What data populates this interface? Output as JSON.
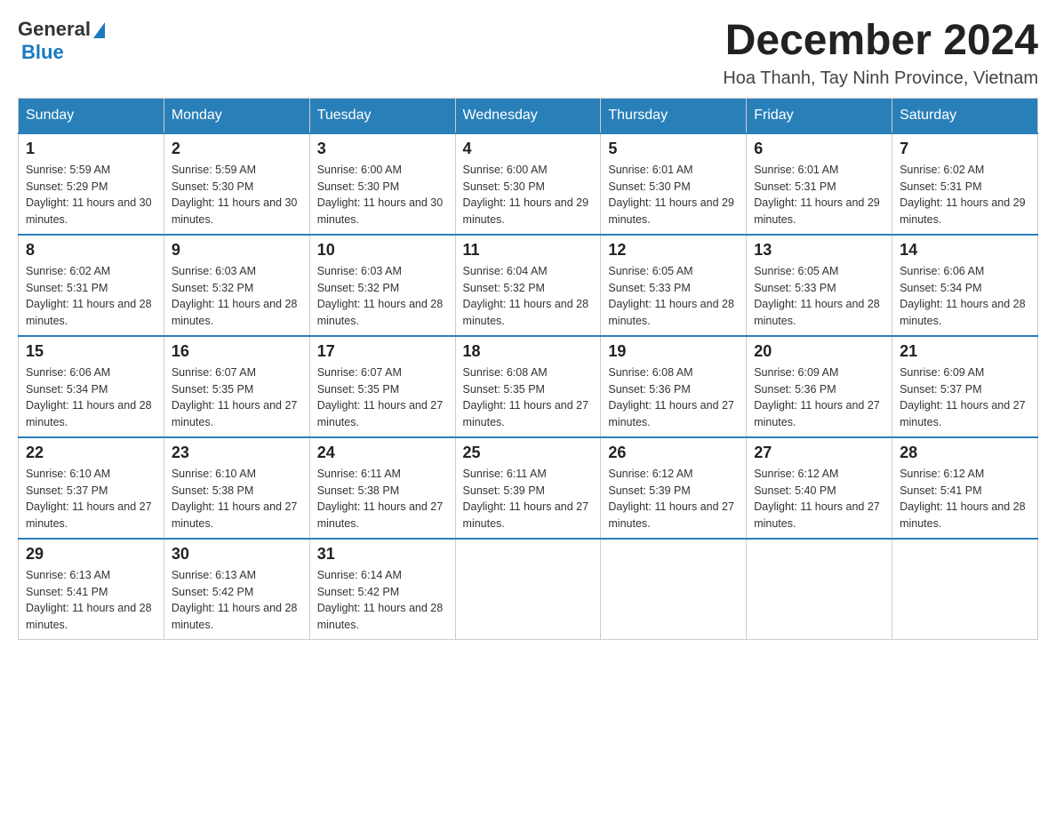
{
  "header": {
    "logo_general": "General",
    "logo_blue": "Blue",
    "month_title": "December 2024",
    "location": "Hoa Thanh, Tay Ninh Province, Vietnam"
  },
  "days_of_week": [
    "Sunday",
    "Monday",
    "Tuesday",
    "Wednesday",
    "Thursday",
    "Friday",
    "Saturday"
  ],
  "weeks": [
    [
      {
        "day": "1",
        "sunrise": "5:59 AM",
        "sunset": "5:29 PM",
        "daylight": "11 hours and 30 minutes."
      },
      {
        "day": "2",
        "sunrise": "5:59 AM",
        "sunset": "5:30 PM",
        "daylight": "11 hours and 30 minutes."
      },
      {
        "day": "3",
        "sunrise": "6:00 AM",
        "sunset": "5:30 PM",
        "daylight": "11 hours and 30 minutes."
      },
      {
        "day": "4",
        "sunrise": "6:00 AM",
        "sunset": "5:30 PM",
        "daylight": "11 hours and 29 minutes."
      },
      {
        "day": "5",
        "sunrise": "6:01 AM",
        "sunset": "5:30 PM",
        "daylight": "11 hours and 29 minutes."
      },
      {
        "day": "6",
        "sunrise": "6:01 AM",
        "sunset": "5:31 PM",
        "daylight": "11 hours and 29 minutes."
      },
      {
        "day": "7",
        "sunrise": "6:02 AM",
        "sunset": "5:31 PM",
        "daylight": "11 hours and 29 minutes."
      }
    ],
    [
      {
        "day": "8",
        "sunrise": "6:02 AM",
        "sunset": "5:31 PM",
        "daylight": "11 hours and 28 minutes."
      },
      {
        "day": "9",
        "sunrise": "6:03 AM",
        "sunset": "5:32 PM",
        "daylight": "11 hours and 28 minutes."
      },
      {
        "day": "10",
        "sunrise": "6:03 AM",
        "sunset": "5:32 PM",
        "daylight": "11 hours and 28 minutes."
      },
      {
        "day": "11",
        "sunrise": "6:04 AM",
        "sunset": "5:32 PM",
        "daylight": "11 hours and 28 minutes."
      },
      {
        "day": "12",
        "sunrise": "6:05 AM",
        "sunset": "5:33 PM",
        "daylight": "11 hours and 28 minutes."
      },
      {
        "day": "13",
        "sunrise": "6:05 AM",
        "sunset": "5:33 PM",
        "daylight": "11 hours and 28 minutes."
      },
      {
        "day": "14",
        "sunrise": "6:06 AM",
        "sunset": "5:34 PM",
        "daylight": "11 hours and 28 minutes."
      }
    ],
    [
      {
        "day": "15",
        "sunrise": "6:06 AM",
        "sunset": "5:34 PM",
        "daylight": "11 hours and 28 minutes."
      },
      {
        "day": "16",
        "sunrise": "6:07 AM",
        "sunset": "5:35 PM",
        "daylight": "11 hours and 27 minutes."
      },
      {
        "day": "17",
        "sunrise": "6:07 AM",
        "sunset": "5:35 PM",
        "daylight": "11 hours and 27 minutes."
      },
      {
        "day": "18",
        "sunrise": "6:08 AM",
        "sunset": "5:35 PM",
        "daylight": "11 hours and 27 minutes."
      },
      {
        "day": "19",
        "sunrise": "6:08 AM",
        "sunset": "5:36 PM",
        "daylight": "11 hours and 27 minutes."
      },
      {
        "day": "20",
        "sunrise": "6:09 AM",
        "sunset": "5:36 PM",
        "daylight": "11 hours and 27 minutes."
      },
      {
        "day": "21",
        "sunrise": "6:09 AM",
        "sunset": "5:37 PM",
        "daylight": "11 hours and 27 minutes."
      }
    ],
    [
      {
        "day": "22",
        "sunrise": "6:10 AM",
        "sunset": "5:37 PM",
        "daylight": "11 hours and 27 minutes."
      },
      {
        "day": "23",
        "sunrise": "6:10 AM",
        "sunset": "5:38 PM",
        "daylight": "11 hours and 27 minutes."
      },
      {
        "day": "24",
        "sunrise": "6:11 AM",
        "sunset": "5:38 PM",
        "daylight": "11 hours and 27 minutes."
      },
      {
        "day": "25",
        "sunrise": "6:11 AM",
        "sunset": "5:39 PM",
        "daylight": "11 hours and 27 minutes."
      },
      {
        "day": "26",
        "sunrise": "6:12 AM",
        "sunset": "5:39 PM",
        "daylight": "11 hours and 27 minutes."
      },
      {
        "day": "27",
        "sunrise": "6:12 AM",
        "sunset": "5:40 PM",
        "daylight": "11 hours and 27 minutes."
      },
      {
        "day": "28",
        "sunrise": "6:12 AM",
        "sunset": "5:41 PM",
        "daylight": "11 hours and 28 minutes."
      }
    ],
    [
      {
        "day": "29",
        "sunrise": "6:13 AM",
        "sunset": "5:41 PM",
        "daylight": "11 hours and 28 minutes."
      },
      {
        "day": "30",
        "sunrise": "6:13 AM",
        "sunset": "5:42 PM",
        "daylight": "11 hours and 28 minutes."
      },
      {
        "day": "31",
        "sunrise": "6:14 AM",
        "sunset": "5:42 PM",
        "daylight": "11 hours and 28 minutes."
      },
      null,
      null,
      null,
      null
    ]
  ]
}
